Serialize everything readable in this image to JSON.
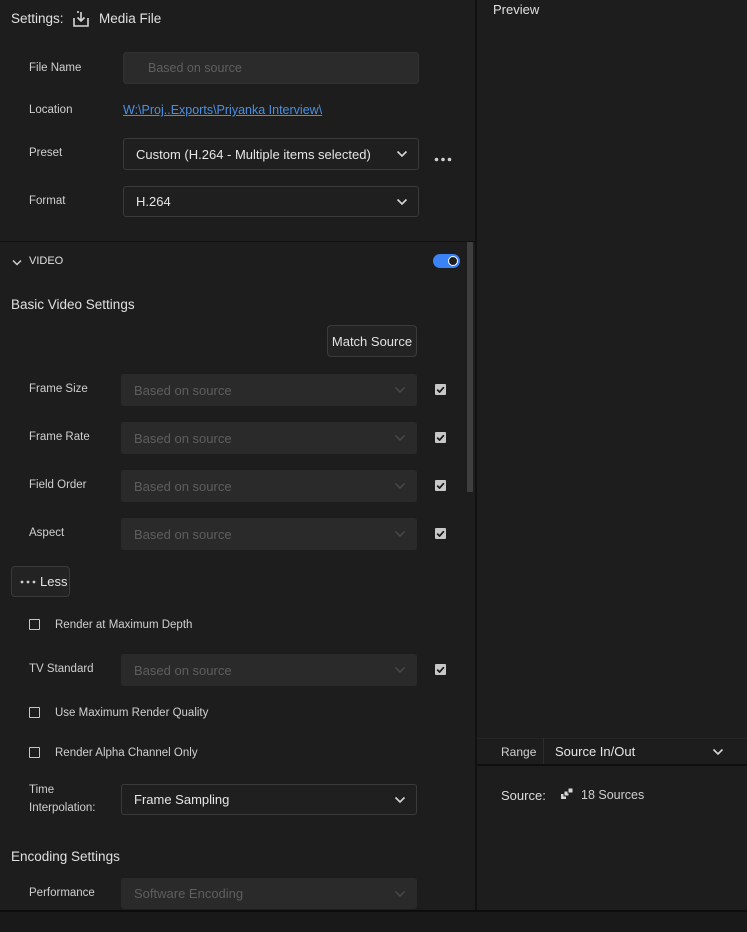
{
  "settings": {
    "label": "Settings:",
    "destination": "Media File",
    "file_name_label": "File Name",
    "file_name_placeholder": "Based on source",
    "location_label": "Location",
    "location_value": "W:\\Proj..Exports\\Priyanka Interview\\",
    "preset_label": "Preset",
    "preset_value": "Custom (H.264 - Multiple items selected)",
    "format_label": "Format",
    "format_value": "H.264"
  },
  "video": {
    "section_label": "VIDEO",
    "enabled": true,
    "basic_heading": "Basic Video Settings",
    "match_source_label": "Match Source",
    "rows": [
      {
        "label": "Frame Size",
        "value": "Based on source",
        "checked": true
      },
      {
        "label": "Frame Rate",
        "value": "Based on source",
        "checked": true
      },
      {
        "label": "Field Order",
        "value": "Based on source",
        "checked": true
      },
      {
        "label": "Aspect",
        "value": "Based on source",
        "checked": true
      }
    ],
    "less_label": "Less",
    "render_max_depth_label": "Render at Maximum Depth",
    "tv_standard_label": "TV Standard",
    "tv_standard_value": "Based on source",
    "max_render_quality_label": "Use Maximum Render Quality",
    "alpha_only_label": "Render Alpha Channel Only",
    "time_interp_label_1": "Time",
    "time_interp_label_2": "Interpolation:",
    "time_interp_value": "Frame Sampling"
  },
  "encoding": {
    "heading": "Encoding Settings",
    "performance_label": "Performance",
    "performance_value": "Software Encoding"
  },
  "preview": {
    "title": "Preview",
    "range_label": "Range",
    "range_value": "Source In/Out",
    "source_label": "Source:",
    "source_value": "18 Sources"
  },
  "colors": {
    "accent": "#3b82f6",
    "link": "#4a90e2"
  }
}
